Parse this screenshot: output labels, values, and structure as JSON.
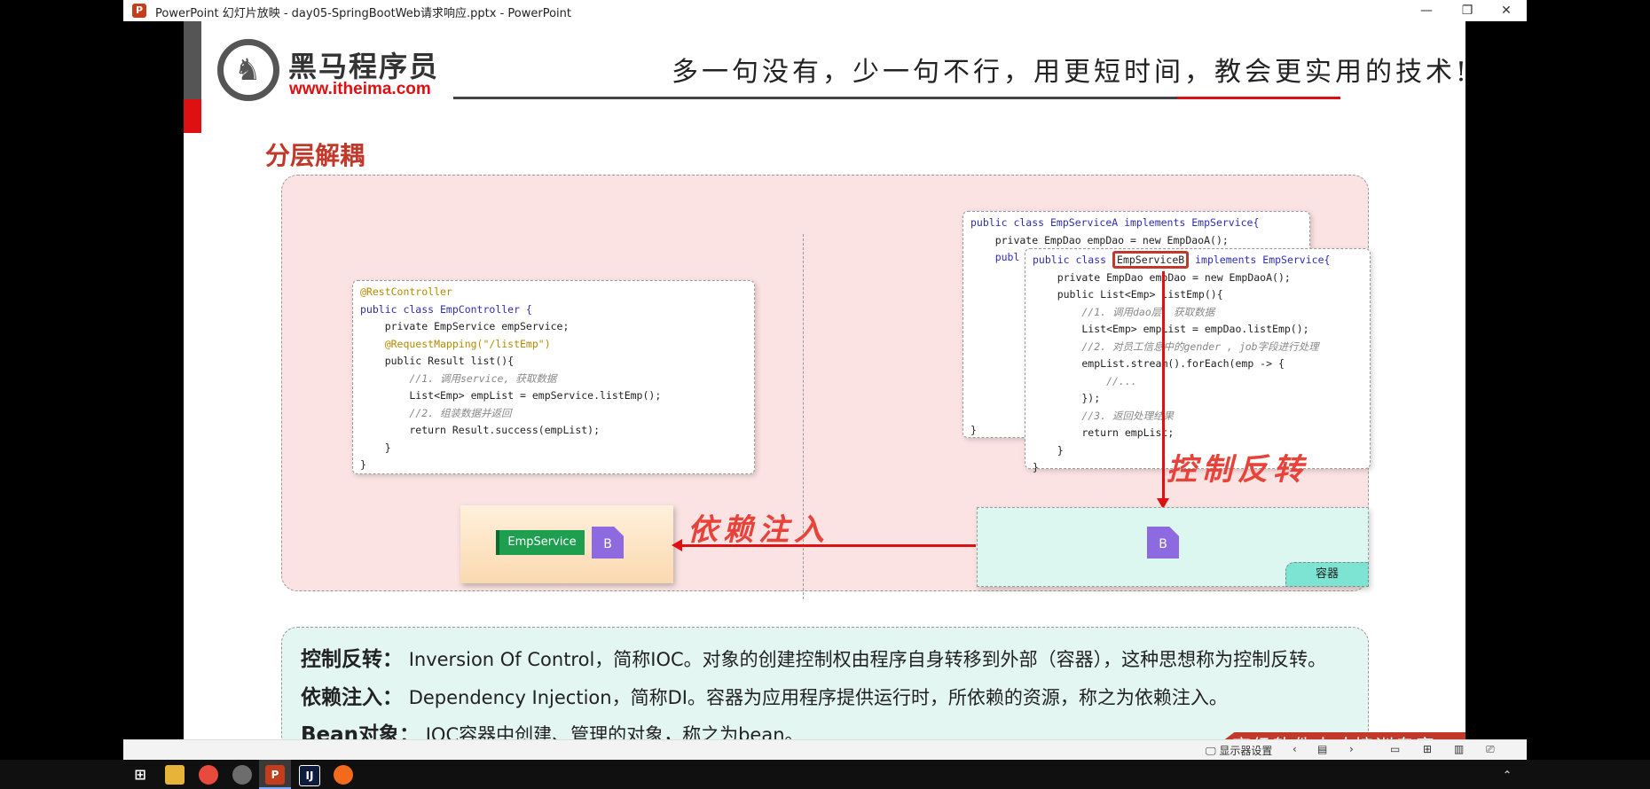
{
  "window": {
    "title": "PowerPoint 幻灯片放映  -  day05-SpringBootWeb请求响应.pptx - PowerPoint",
    "app_icon": "P",
    "controls": [
      "—",
      "❐",
      "✕"
    ]
  },
  "slide": {
    "logo_name": "黑马程序员",
    "logo_url": "www.itheima.com",
    "slogan": "多一句没有，少一句不行，用更短时间，教会更实用的技术!",
    "section_title": "分层解耦",
    "controller_code": [
      "@RestController",
      "public class EmpController {",
      "    private EmpService empService;",
      "    @RequestMapping(\"/listEmp\")",
      "    public Result list(){",
      "        //1. 调用service, 获取数据",
      "        List<Emp> empList = empService.listEmp();",
      "        //2. 组装数据并返回",
      "        return Result.success(empList);",
      "    }",
      "}"
    ],
    "service_a_code": [
      "public class EmpServiceA implements EmpService{",
      "    private EmpDao empDao = new EmpDaoA();",
      "    publ",
      "}"
    ],
    "service_b_code": {
      "line1_pre": "public class ",
      "line1_cls": "EmpServiceB",
      "line1_post": " implements EmpService{",
      "lines": [
        "    private EmpDao empDao = new EmpDaoA();",
        "    public List<Emp> listEmp(){",
        "        //1. 调用dao层, 获取数据",
        "        List<Emp> empList = empDao.listEmp();",
        "        //2. 对员工信息中的gender , job字段进行处理",
        "        empList.stream().forEach(emp -> {",
        "            //...",
        "        });",
        "        //3. 返回处理结果",
        "        return empList;",
        "    }",
        "}"
      ]
    },
    "empservice_tag": "EmpService",
    "bean_label": "B",
    "container_label": "容器",
    "ioc_hand_label": "控制反转",
    "di_hand_label": "依赖注入",
    "definitions": {
      "ioc_term": "控制反转：",
      "ioc_text": "Inversion Of Control，简称IOC。对象的创建控制权由程序自身转移到外部（容器），这种思想称为控制反转。",
      "di_term": "依赖注入：",
      "di_text": "Dependency Injection，简称DI。容器为应用程序提供运行时，所依赖的资源，称之为依赖注入。",
      "bean_term": "Bean对象：",
      "bean_text": "IOC容器中创建、管理的对象，称之为bean。"
    },
    "banner": "高级软件人才培训专家"
  },
  "statusbar": {
    "display_settings": "显示器设置"
  },
  "colors": {
    "accent_red": "#c0392b",
    "diagram_bg": "#fbe3e3",
    "definition_bg": "#e3f6f1",
    "container_green": "#7de3d2",
    "bean_purple": "#8e6ae0"
  }
}
